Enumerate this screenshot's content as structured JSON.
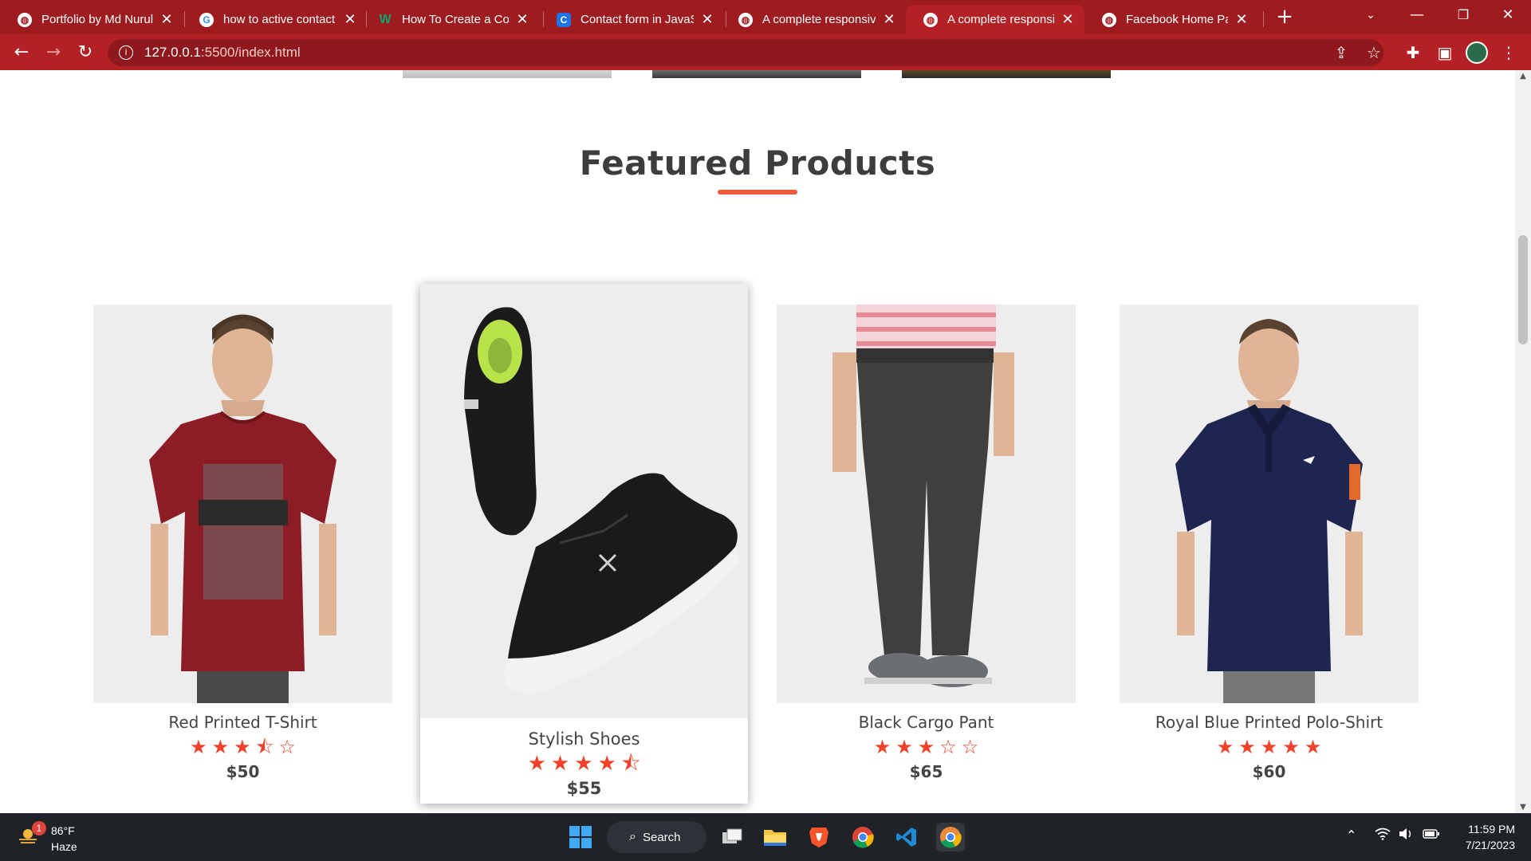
{
  "browser": {
    "tabs": [
      {
        "title": "Portfolio by Md Nurul",
        "favicon": "globe-icon",
        "active": false
      },
      {
        "title": "how to active contact",
        "favicon": "google-icon",
        "active": false
      },
      {
        "title": "How To Create a Cont",
        "favicon": "w3-icon",
        "active": false
      },
      {
        "title": "Contact form in JavaS",
        "favicon": "c-icon",
        "active": false
      },
      {
        "title": "A complete responsiv",
        "favicon": "globe-icon",
        "active": false
      },
      {
        "title": "A complete responsiv",
        "favicon": "globe-icon",
        "active": true
      },
      {
        "title": "Facebook Home Page",
        "favicon": "globe-icon",
        "active": false
      }
    ],
    "address": {
      "host": "127.0.0.1",
      "path": ":5500/index.html"
    },
    "colors": {
      "frame": "#9e1b1f",
      "toolbar": "#b42125"
    }
  },
  "page": {
    "section_title": "Featured Products",
    "accent": "#f05a3c",
    "products": [
      {
        "name": "Red Printed T-Shirt",
        "rating": 3.5,
        "price": "$50",
        "featured": false
      },
      {
        "name": "Stylish Shoes",
        "rating": 4.5,
        "price": "$55",
        "featured": true
      },
      {
        "name": "Black Cargo Pant",
        "rating": 3,
        "price": "$65",
        "featured": false
      },
      {
        "name": "Royal Blue Printed Polo-Shirt",
        "rating": 5,
        "price": "$60",
        "featured": false
      }
    ]
  },
  "taskbar": {
    "weather": {
      "temp": "86°F",
      "condition": "Haze",
      "badge": "1"
    },
    "search_label": "Search",
    "time": "11:59 PM",
    "date": "7/21/2023"
  }
}
